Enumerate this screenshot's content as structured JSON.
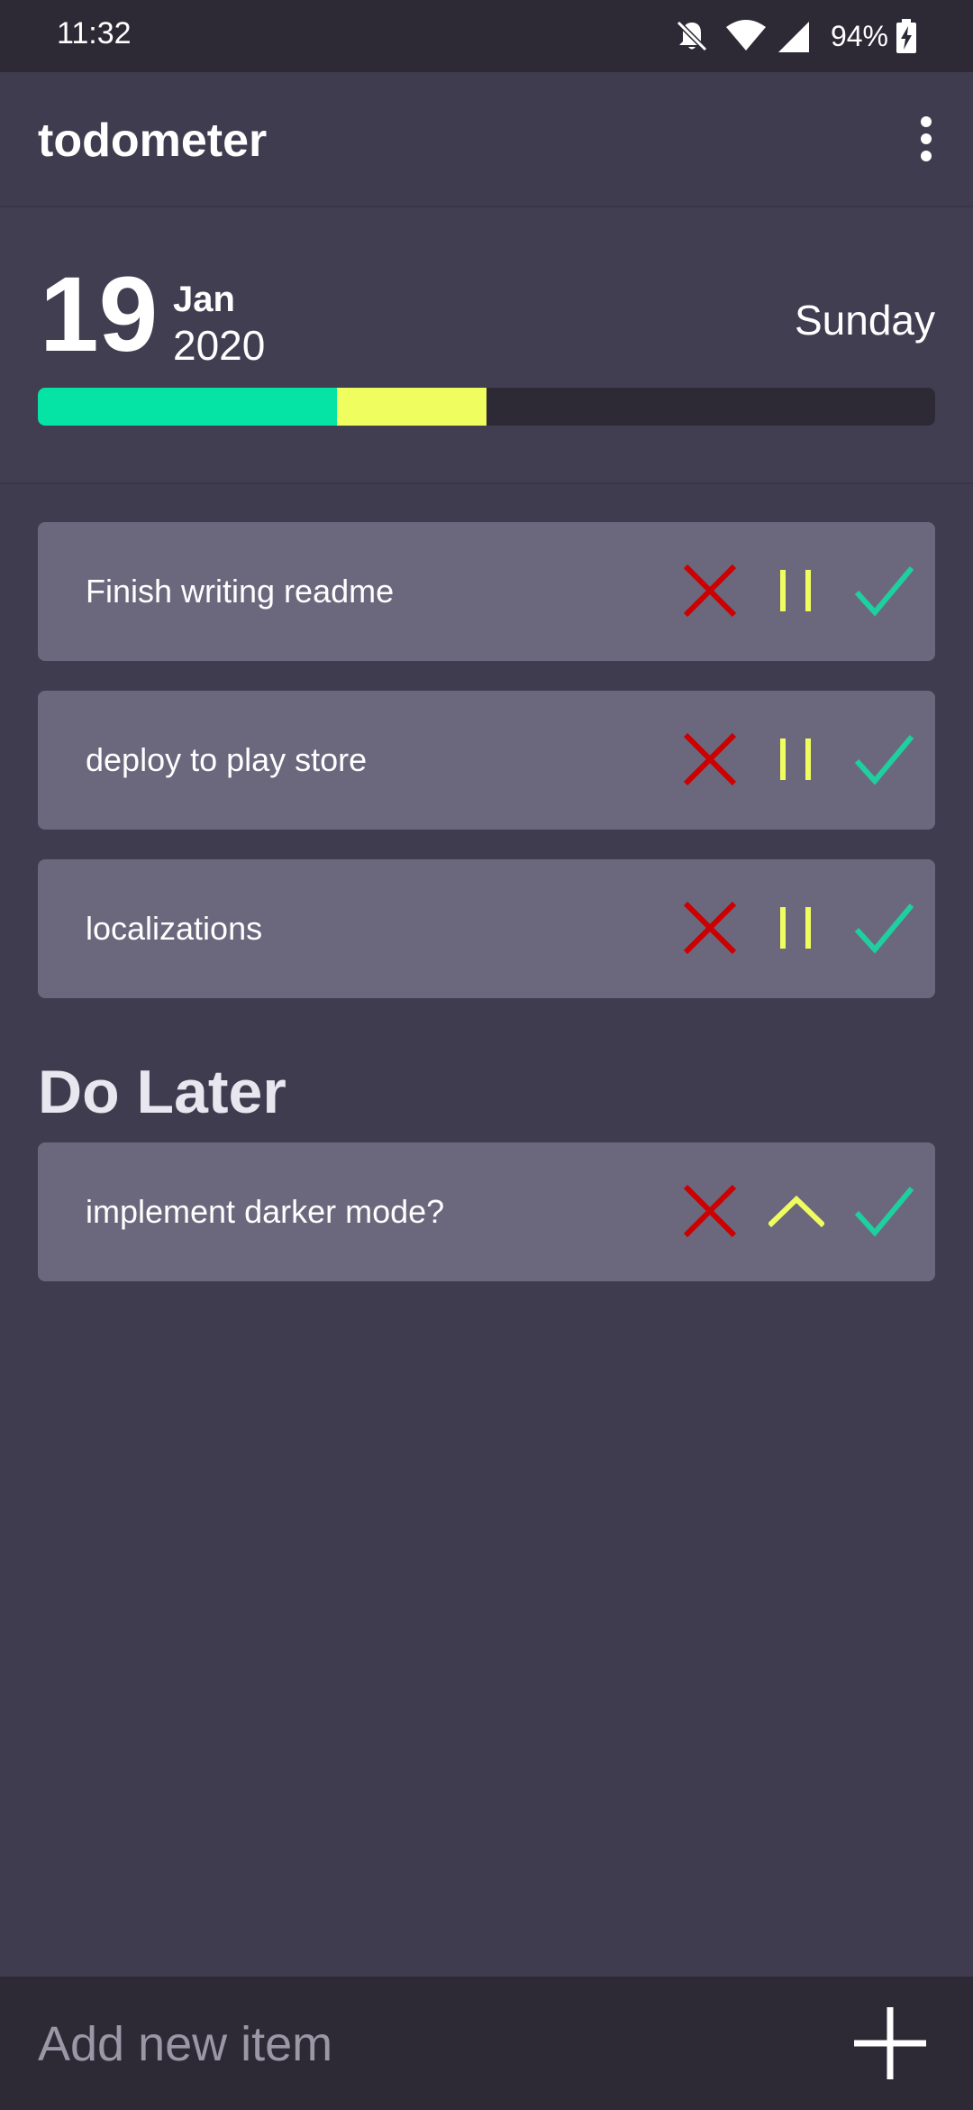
{
  "status_bar": {
    "time": "11:32",
    "battery_percent": "94%",
    "icons": [
      "notifications-off-icon",
      "wifi-icon",
      "cell-signal-icon",
      "battery-charging-icon"
    ]
  },
  "app_bar": {
    "title": "todometer",
    "menu_icon": "more-vert-icon"
  },
  "date_panel": {
    "day": "19",
    "month": "Jan",
    "year": "2020",
    "weekday": "Sunday",
    "progress": {
      "completed_fraction": 0.333,
      "paused_fraction": 0.167,
      "colors": {
        "completed": "#05e4a5",
        "paused": "#f0fd5e",
        "track": "#2d2a36"
      }
    }
  },
  "tasks": [
    {
      "label": "Finish writing readme",
      "actions": [
        "delete-icon",
        "pause-icon",
        "complete-icon"
      ]
    },
    {
      "label": "deploy to play store",
      "actions": [
        "delete-icon",
        "pause-icon",
        "complete-icon"
      ]
    },
    {
      "label": "localizations",
      "actions": [
        "delete-icon",
        "pause-icon",
        "complete-icon"
      ]
    }
  ],
  "do_later": {
    "title": "Do Later",
    "items": [
      {
        "label": "implement darker mode?",
        "actions": [
          "delete-icon",
          "resume-icon",
          "complete-icon"
        ]
      }
    ]
  },
  "bottom_bar": {
    "placeholder": "Add new item",
    "add_icon": "plus-icon"
  },
  "colors": {
    "background": "#403c4f",
    "card": "#6b687e",
    "delete": "#cc0000",
    "pause": "#f0fd5e",
    "complete": "#1ecfa0"
  }
}
